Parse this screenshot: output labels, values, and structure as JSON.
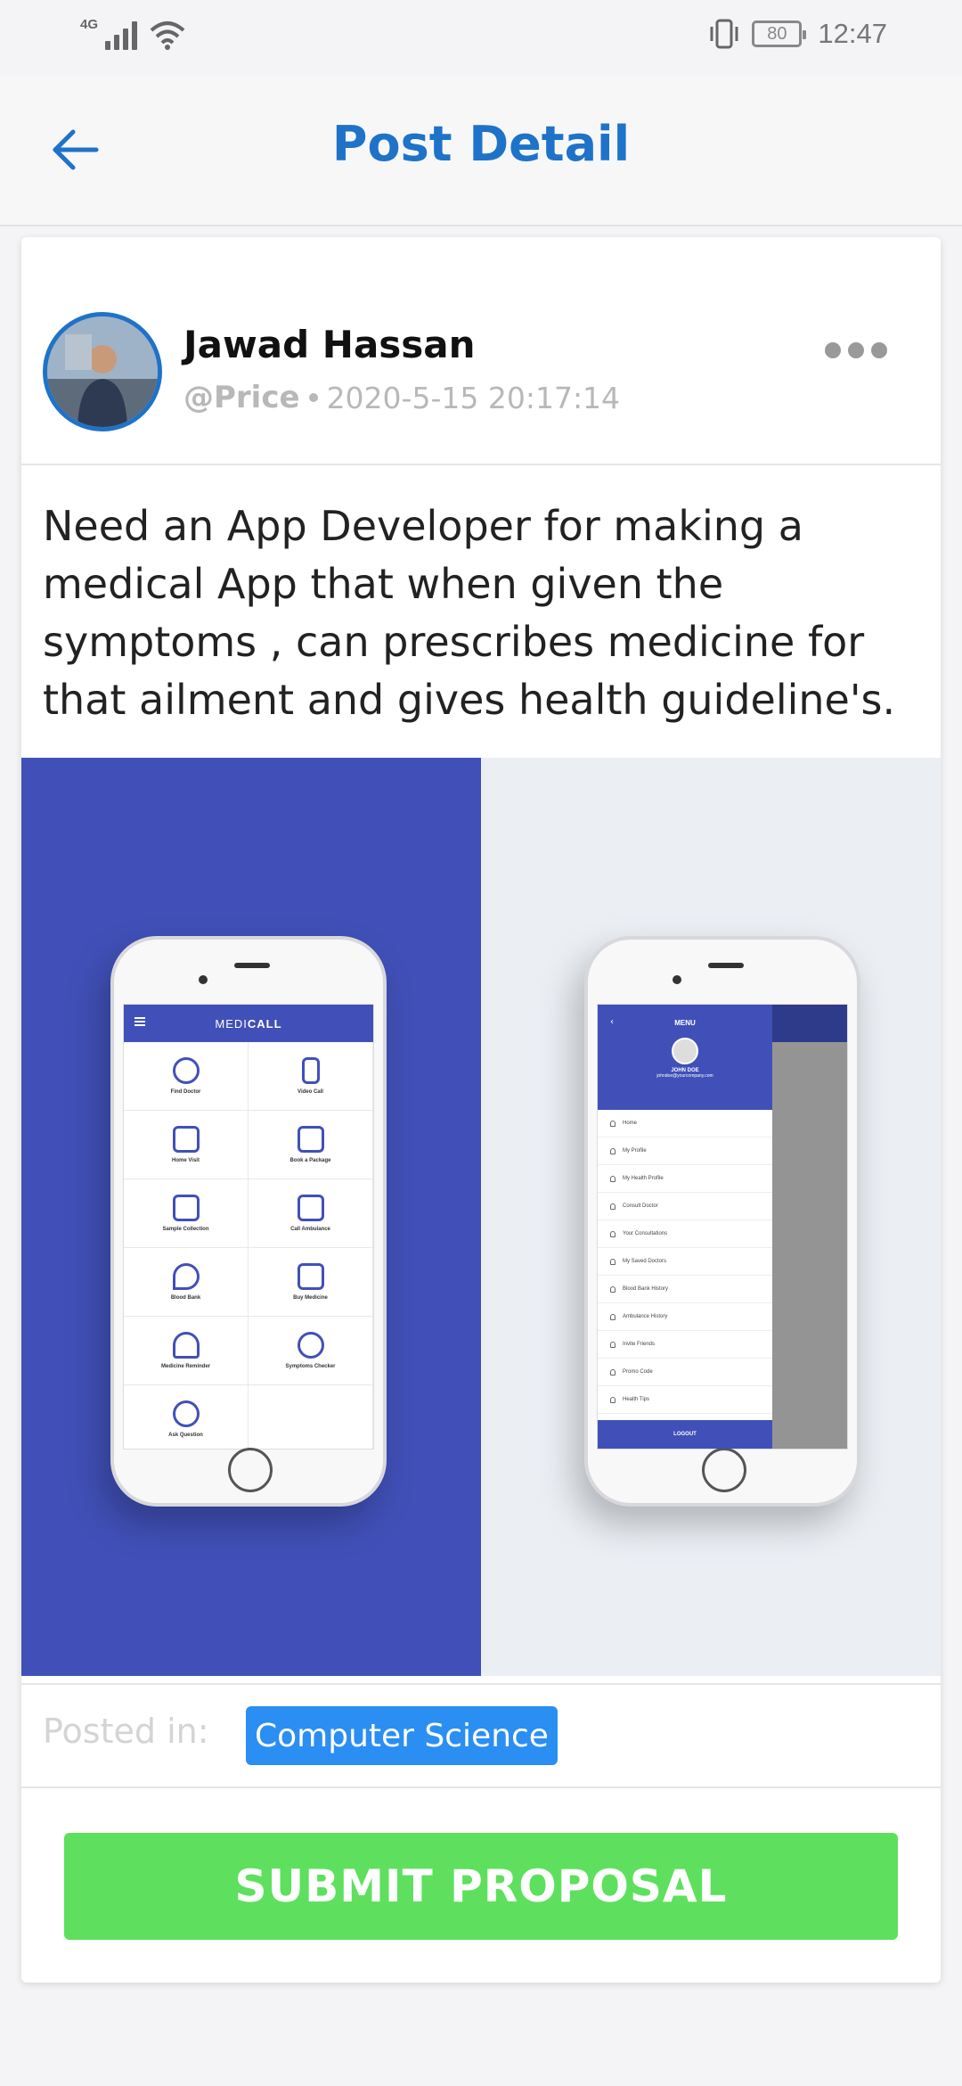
{
  "status_bar": {
    "network": "4G",
    "battery": "80",
    "time": "12:47"
  },
  "app_bar": {
    "title": "Post Detail"
  },
  "post": {
    "author": "Jawad Hassan",
    "handle": "@Price",
    "timestamp": "2020-5-15 20:17:14",
    "body": "Need an App Developer for making a medical App that when given the symptoms , can prescribes medicine for that ailment and gives health guideline's.",
    "posted_in_label": "Posted in:",
    "category": "Computer Science",
    "submit_label": "SUBMIT PROPOSAL"
  },
  "image": {
    "phone1": {
      "brand_light": "MEDI",
      "brand_bold": "CALL",
      "tiles": [
        {
          "label": "Find Doctor"
        },
        {
          "label": "Video Call"
        },
        {
          "label": "Home Visit"
        },
        {
          "label": "Book a Package"
        },
        {
          "label": "Sample Collection"
        },
        {
          "label": "Call Ambulance"
        },
        {
          "label": "Blood Bank"
        },
        {
          "label": "Buy Medicine"
        },
        {
          "label": "Medicine Reminder"
        },
        {
          "label": "Symptoms Checker"
        },
        {
          "label": "Ask Question"
        }
      ]
    },
    "phone2": {
      "menu_title": "MENU",
      "user_name": "JOHN DOE",
      "user_email": "johndoe@yourcompany.com",
      "items": [
        "Home",
        "My Profile",
        "My Health Profile",
        "Consult Doctor",
        "Your Consultations",
        "My Saved Doctors",
        "Blood Bank History",
        "Ambulance History",
        "Invite Friends",
        "Promo Code",
        "Health Tips"
      ],
      "logout": "LOGOUT"
    }
  },
  "colors": {
    "primary": "#1e73c8",
    "image_blue": "#4150b8",
    "chip": "#2b8ef2",
    "submit": "#5ee05e"
  }
}
